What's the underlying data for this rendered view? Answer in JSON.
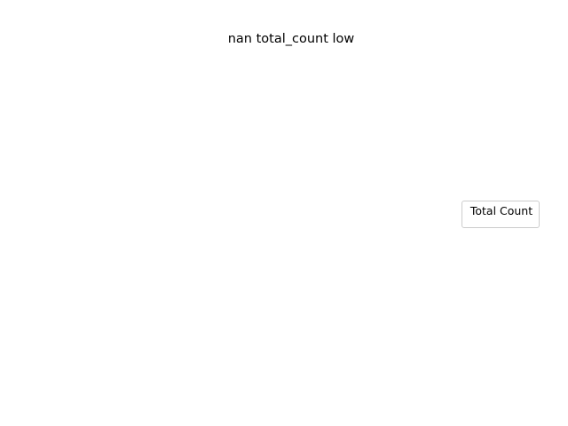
{
  "chart_data": {
    "type": "bar",
    "title": "nan total_count low",
    "xlabel": "",
    "ylabel": "",
    "categories": [],
    "series": [],
    "axes_visible": false,
    "grid": false,
    "legend": {
      "title": "Total Count",
      "placement": "center-right",
      "entries": []
    }
  },
  "colors": {
    "background": "#ffffff",
    "text": "#000000",
    "legend_border": "#cccccc"
  }
}
